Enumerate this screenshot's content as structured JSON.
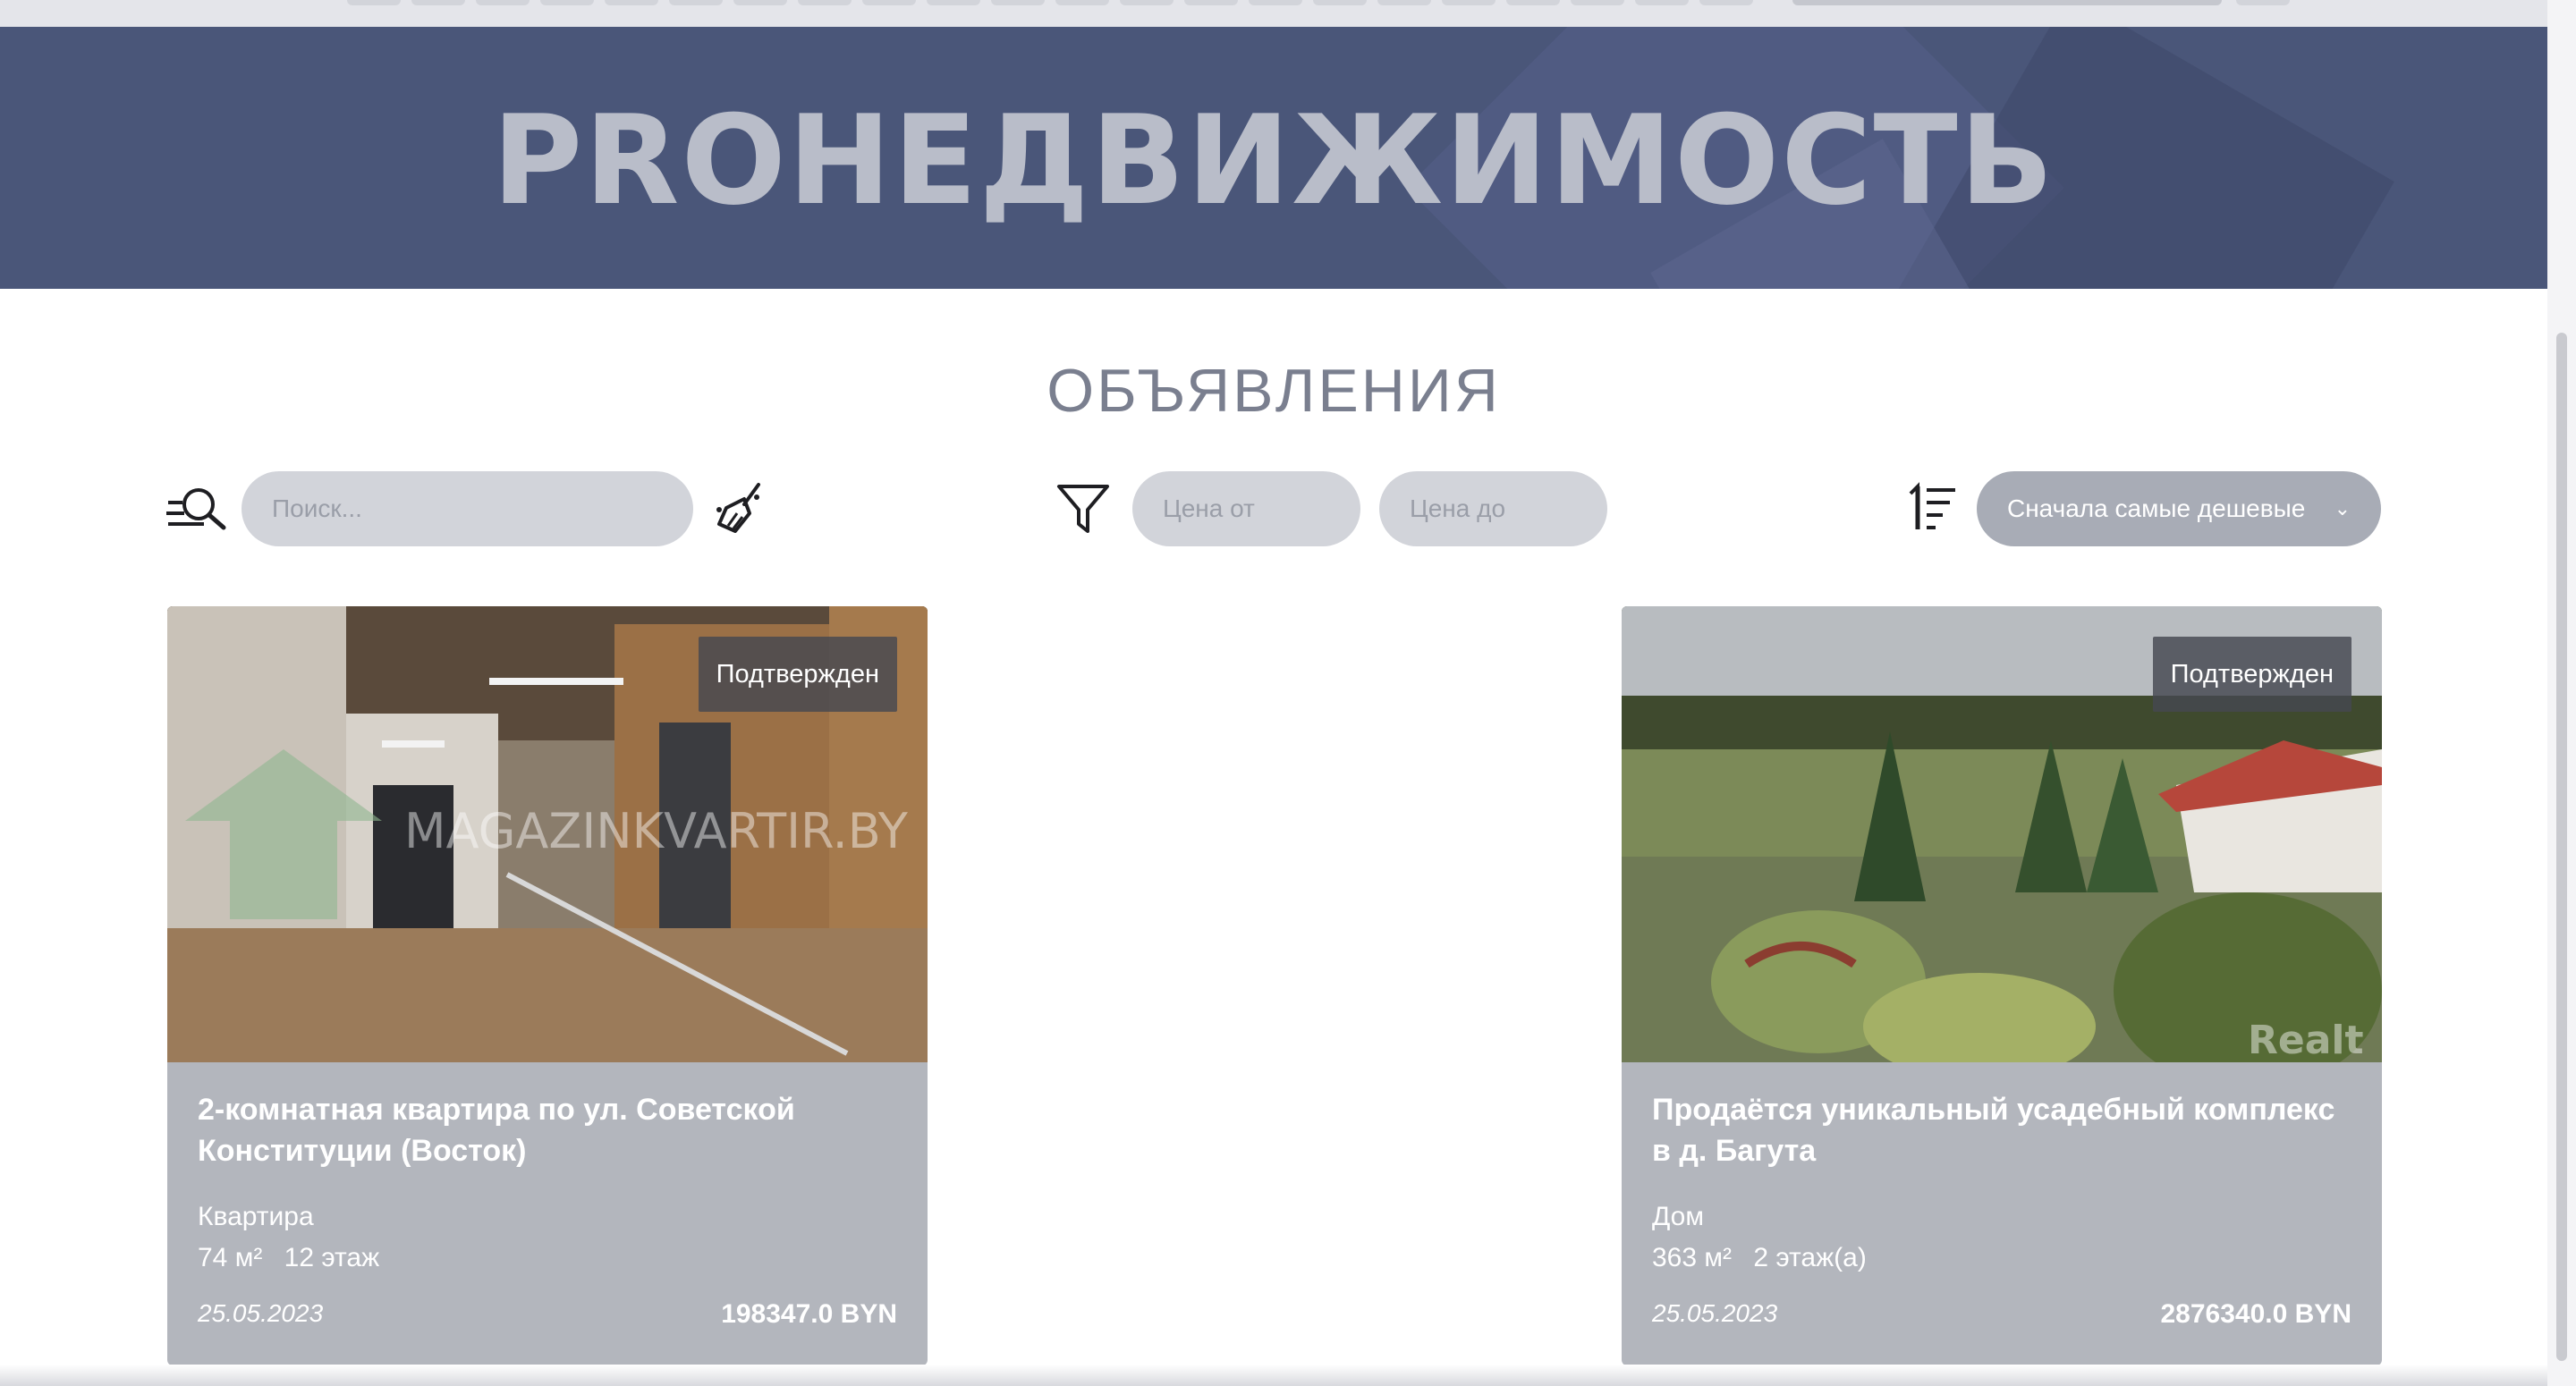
{
  "hero": {
    "title": "PROНЕДВИЖИМОСТЬ"
  },
  "section": {
    "title": "ОБЪЯВЛЕНИЯ"
  },
  "toolbar": {
    "search_placeholder": "Поиск...",
    "price_from_placeholder": "Цена от",
    "price_to_placeholder": "Цена до",
    "sort_selected": "Сначала самые дешевые",
    "sort_chevron": "⌄"
  },
  "listings": [
    {
      "badge": "Подтвержден",
      "title": "2-комнатная квартира по ул. Советской Конституции (Восток)",
      "kind": "Квартира",
      "area": "74 м²",
      "floor": "12 этаж",
      "date": "25.05.2023",
      "price": "198347.0 BYN",
      "watermark": "MAGAZINKVARTIR.BY"
    },
    {
      "badge": "Подтвержден",
      "title": "Продаётся уникальный усадебный комплекс в д. Багута",
      "kind": "Дом",
      "area": "363 м²",
      "floor": "2 этаж(а)",
      "date": "25.05.2023",
      "price": "2876340.0 BYN",
      "watermark": "Realt"
    }
  ],
  "icons": {
    "search": "search-icon",
    "clear": "broom-icon",
    "filter": "filter-icon",
    "sort": "sort-icon"
  },
  "colors": {
    "hero_bg": "#4a5679",
    "hero_text": "#b9bdc9",
    "card_bg": "#b3b6bd",
    "input_bg": "#d2d4da",
    "select_bg": "#a8acb6"
  }
}
